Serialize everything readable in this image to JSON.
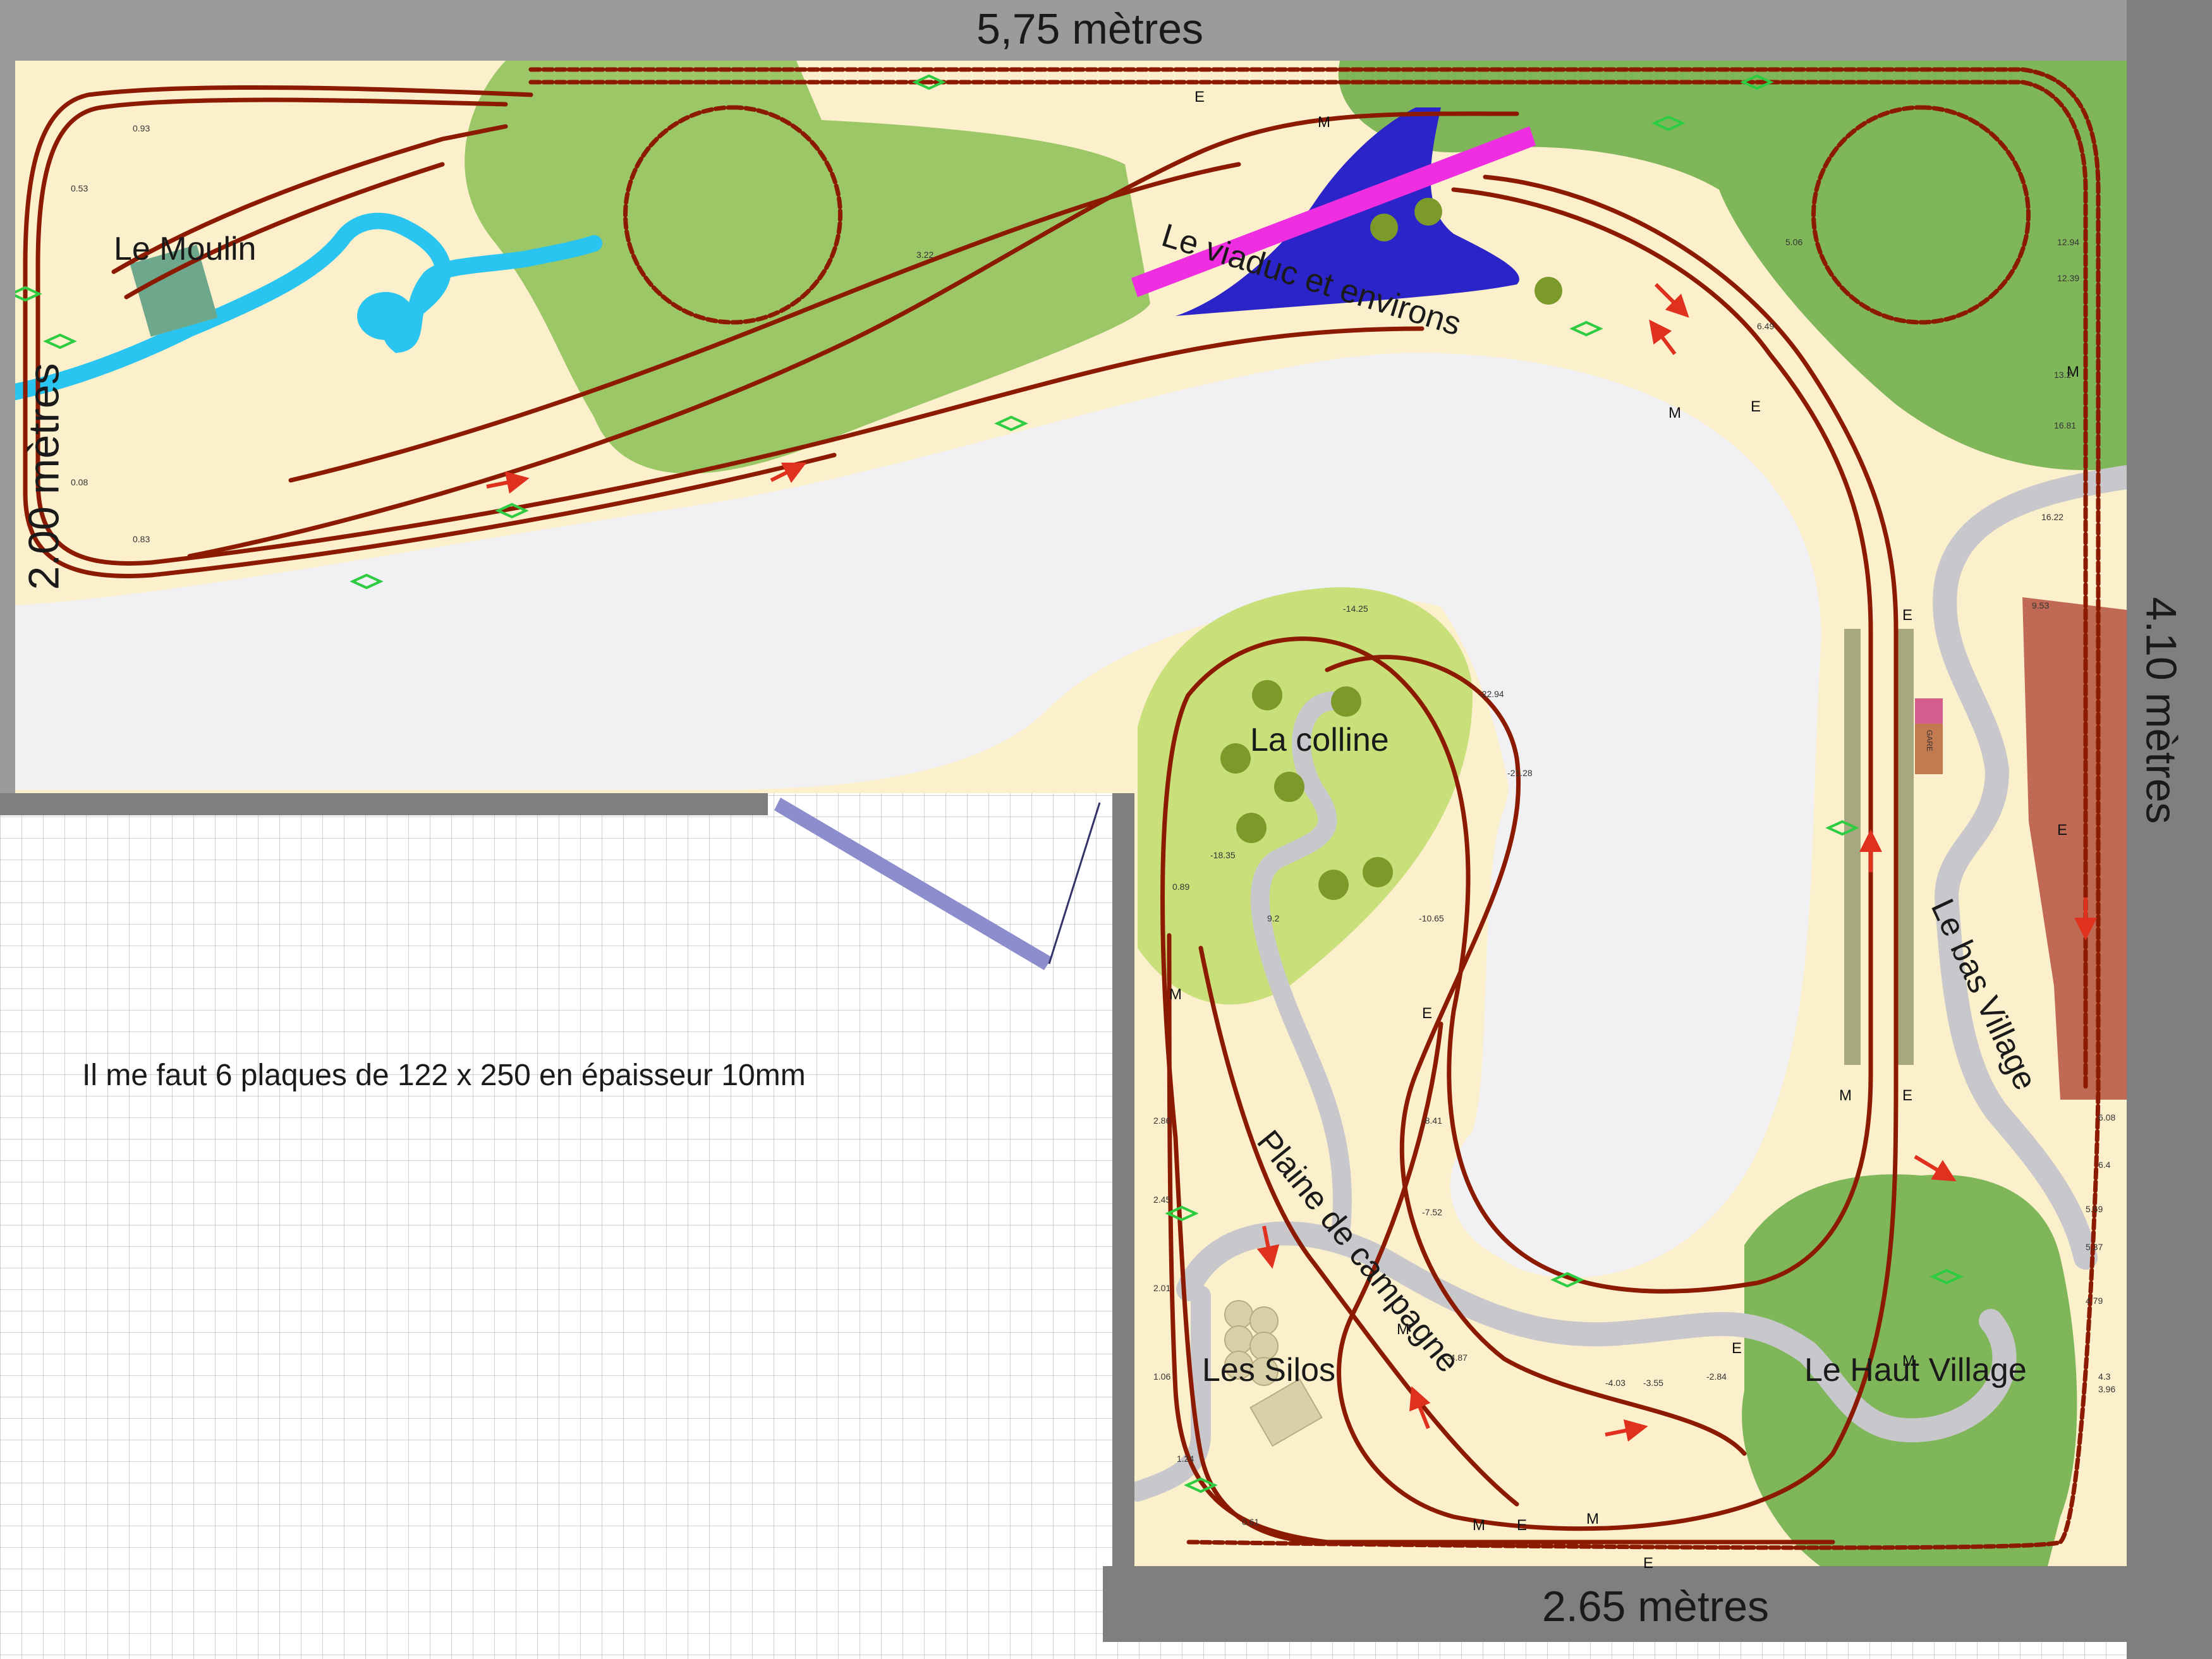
{
  "dimensions": {
    "top": "5,75 mètres",
    "left": "2.00 mètres",
    "right": "4.10 mètres",
    "bottom": "2.65 mètres"
  },
  "zones": {
    "moulin": "Le Moulin",
    "viaduc": "Le viaduc et environs",
    "colline": "La colline",
    "bas_village": "Le bas Village",
    "plaine": "Plaine de campagne",
    "silos": "Les Silos",
    "haut_village": "Le Haut Village"
  },
  "note": "Il me faut 6 plaques de 122 x 250 en épaisseur 10mm",
  "station_label": "GARE",
  "track_letters": [
    "E",
    "M",
    "E",
    "M",
    "E",
    "M",
    "M",
    "E",
    "E",
    "M",
    "E",
    "M",
    "E",
    "M",
    "M",
    "E",
    "E",
    "M"
  ],
  "elevation_marks": [
    "0.93",
    "0.53",
    "0.08",
    "0.83",
    "3.22",
    "5.06",
    "6.49",
    "12.94",
    "12.39",
    "13.2",
    "16.81",
    "16.22",
    "9.53",
    "6.08",
    "6.4",
    "5.69",
    "5.37",
    "4.79",
    "4.3",
    "3.96",
    "-14.25",
    "-22.94",
    "-21.28",
    "-18.35",
    "-10.65",
    "-8.41",
    "-7.52",
    "-4.87",
    "-4.03",
    "-3.55",
    "-2.84",
    "2.86",
    "2.45",
    "2.01",
    "1.06",
    "1.24",
    "0.61",
    "0.89",
    "9.2"
  ],
  "colors": {
    "board": "#fbefcc",
    "frame": "#9b9b9b",
    "grass_dark": "#7fb65a",
    "grass_light": "#c8df7a",
    "road": "#c8c8cc",
    "water": "#29c5f0",
    "track": "#8b1a00",
    "viaduct": "#ee2ee0",
    "lake": "#2b24c8",
    "arrow_red": "#e0301e",
    "turnout_green": "#2ecc40",
    "bas_village_block": "#c06a55",
    "aisle": "#f0f0f2"
  }
}
